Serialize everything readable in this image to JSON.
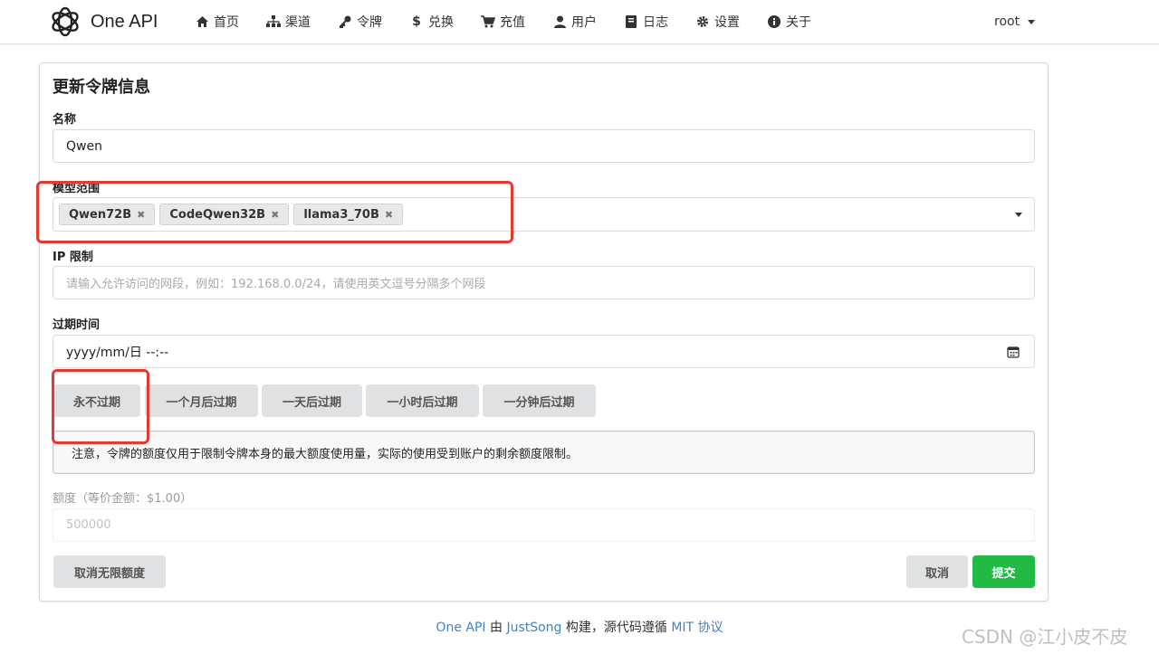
{
  "header": {
    "brand": "One API",
    "nav": [
      {
        "label": "首页",
        "icon": "home-icon"
      },
      {
        "label": "渠道",
        "icon": "sitemap-icon"
      },
      {
        "label": "令牌",
        "icon": "key-icon"
      },
      {
        "label": "兑换",
        "icon": "dollar-icon"
      },
      {
        "label": "充值",
        "icon": "cart-icon"
      },
      {
        "label": "用户",
        "icon": "user-icon"
      },
      {
        "label": "日志",
        "icon": "book-icon"
      },
      {
        "label": "设置",
        "icon": "gear-icon"
      },
      {
        "label": "关于",
        "icon": "info-icon"
      }
    ],
    "user": "root"
  },
  "form": {
    "title": "更新令牌信息",
    "name_label": "名称",
    "name_value": "Qwen",
    "models_label": "模型范围",
    "models": [
      "Qwen72B",
      "CodeQwen32B",
      "llama3_70B"
    ],
    "ip_label": "IP 限制",
    "ip_placeholder": "请输入允许访问的网段，例如：192.168.0.0/24，请使用英文逗号分隔多个网段",
    "expire_label": "过期时间",
    "expire_value": "yyyy/mm/日 --:--",
    "expire_buttons": [
      "永不过期",
      "一个月后过期",
      "一天后过期",
      "一小时后过期",
      "一分钟后过期"
    ],
    "notice": "注意，令牌的额度仅用于限制令牌本身的最大额度使用量，实际的使用受到账户的剩余额度限制。",
    "quota_label": "额度（等价金额：$1.00）",
    "quota_value": "500000",
    "unlimited_button": "取消无限额度",
    "cancel_button": "取消",
    "submit_button": "提交"
  },
  "footer": {
    "brand_link": "One API",
    "by": " 由 ",
    "author_link": "JustSong",
    "middle": " 构建，源代码遵循 ",
    "license_link": "MIT 协议"
  },
  "watermark": "CSDN @江小皮不皮",
  "colors": {
    "primary_button": "#21ba45",
    "highlight_box": "#e53935",
    "link": "#4183c4"
  }
}
